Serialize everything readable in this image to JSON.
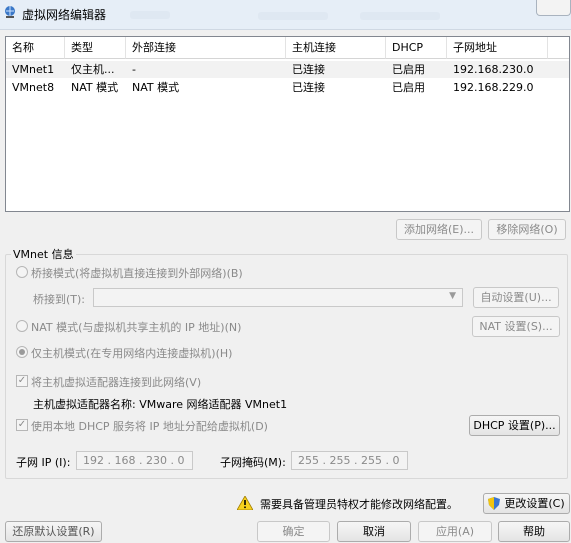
{
  "window": {
    "title": "虚拟网络编辑器"
  },
  "list": {
    "headers": [
      "名称",
      "类型",
      "外部连接",
      "主机连接",
      "DHCP",
      "子网地址"
    ],
    "rows": [
      [
        "VMnet1",
        "仅主机...",
        "-",
        "已连接",
        "已启用",
        "192.168.230.0"
      ],
      [
        "VMnet8",
        "NAT 模式",
        "NAT 模式",
        "已连接",
        "已启用",
        "192.168.229.0"
      ]
    ]
  },
  "list_buttons": {
    "add": "添加网络(E)...",
    "remove": "移除网络(O)"
  },
  "vmnet_info": {
    "legend": "VMnet 信息",
    "bridged_label": "桥接模式(将虚拟机直接连接到外部网络)(B)",
    "bridged_to_label": "桥接到(T):",
    "auto_settings": "自动设置(U)...",
    "nat_label": "NAT 模式(与虚拟机共享主机的 IP 地址)(N)",
    "nat_settings": "NAT 设置(S)...",
    "hostonly_label": "仅主机模式(在专用网络内连接虚拟机)(H)",
    "connect_adapter_label": "将主机虚拟适配器连接到此网络(V)",
    "adapter_name_label": "主机虚拟适配器名称: VMware 网络适配器 VMnet1",
    "dhcp_label": "使用本地 DHCP 服务将 IP 地址分配给虚拟机(D)",
    "dhcp_settings": "DHCP 设置(P)...",
    "subnet_ip_label": "子网 IP (I):",
    "subnet_ip": "192 . 168 . 230 .  0",
    "subnet_mask_label": "子网掩码(M):",
    "subnet_mask": "255 . 255 . 255 .  0"
  },
  "admin_notice": "需要具备管理员特权才能修改网络配置。",
  "buttons": {
    "change_settings": "更改设置(C)",
    "restore_defaults": "还原默认设置(R)",
    "ok": "确定",
    "cancel": "取消",
    "apply": "应用(A)",
    "help": "帮助"
  }
}
